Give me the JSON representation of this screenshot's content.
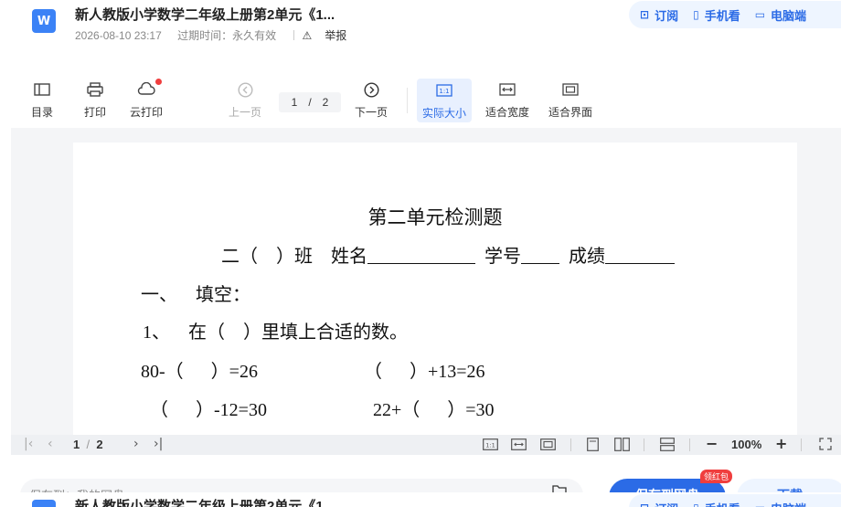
{
  "header": {
    "title": "新人教版小学数学二年级上册第2单元《1...",
    "date": "2026-08-10 23:17",
    "expiry": "过期时间：永久有效",
    "report": "举报",
    "actions": [
      "订阅",
      "手机看",
      "电脑端"
    ]
  },
  "toolbar": {
    "catalog": "目录",
    "print": "打印",
    "cloud_print": "云打印",
    "prev": "上一页",
    "current_page": "1",
    "page_sep": "/",
    "total_pages": "2",
    "next": "下一页",
    "actual_size": "实际大小",
    "fit_width": "适合宽度",
    "fit_page": "适合界面",
    "actual_size_icon": "1:1"
  },
  "document": {
    "title": "第二单元检测题",
    "line_class": "二（    ）班    姓名",
    "line_id": "  学号",
    "line_score": "  成绩",
    "section1": "一、    填空：",
    "q1": "1、    在（    ）里填上合适的数。",
    "eq1": "80-（      ）=26",
    "eq2": "（      ）+13=26",
    "eq3": "（      ）-12=30",
    "eq4": "22+（      ）=30"
  },
  "bottombar": {
    "current_page": "1",
    "page_sep": "/",
    "total_pages": "2",
    "zoom": "100%",
    "actual_size_icon": "1:1"
  },
  "footer": {
    "save_to": "保存到：我的网盘",
    "save_button": "保存到网盘",
    "red_packet": "领红包",
    "download": "下载"
  },
  "colors": {
    "accent": "#2b6be6",
    "accent_light": "#eef5ff",
    "red": "#f03e3e"
  }
}
